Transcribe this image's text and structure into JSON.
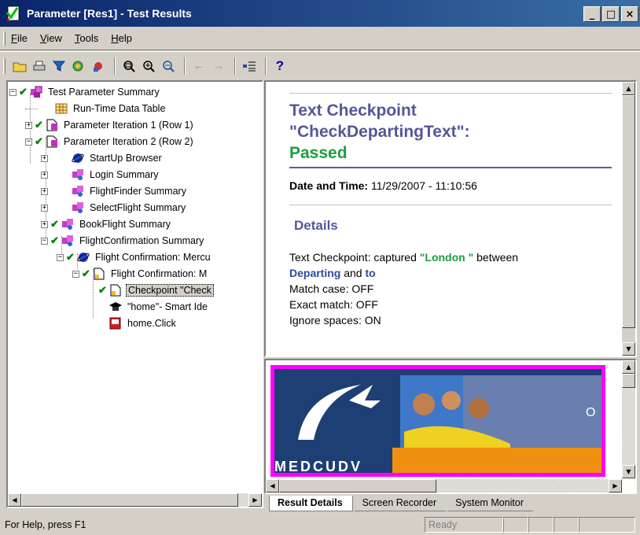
{
  "window": {
    "title": "Parameter [Res1] - Test Results",
    "min": "_",
    "max": "□",
    "close": "×"
  },
  "menu": [
    {
      "label": "File",
      "key": "F",
      "rest": "ile"
    },
    {
      "label": "View",
      "key": "V",
      "rest": "iew"
    },
    {
      "label": "Tools",
      "key": "T",
      "rest": "ools"
    },
    {
      "label": "Help",
      "key": "H",
      "rest": "elp"
    }
  ],
  "tree": {
    "root": "Test Parameter Summary",
    "runtime": "Run-Time Data Table",
    "iter1": "Parameter Iteration 1 (Row 1)",
    "iter2": "Parameter Iteration 2 (Row 2)",
    "startup": "StartUp Browser",
    "login": "Login Summary",
    "flightfinder": "FlightFinder Summary",
    "selectflight": "SelectFlight Summary",
    "bookflight": "BookFlight Summary",
    "confirmation": "FlightConfirmation Summary",
    "fc1": "Flight Confirmation: Mercu",
    "fc2": "Flight Confirmation: M",
    "checkpoint": "Checkpoint \"Check",
    "smart": "\"home\"- Smart Ide",
    "click": "home.Click"
  },
  "details": {
    "title_line1": "Text Checkpoint",
    "title_line2": "\"CheckDepartingText\":",
    "status": "Passed",
    "datetime_label": "Date and Time:",
    "datetime_value": "11/29/2007 - 11:10:56",
    "details_heading": "Details",
    "captured_prefix": "Text Checkpoint: captured ",
    "captured_value": "\"London \"",
    "captured_between": " between",
    "departing": "Departing",
    "and": " and ",
    "to": "to",
    "match_case": "Match case: OFF",
    "exact_match": "Exact match: OFF",
    "ignore_spaces": "Ignore spaces: ON"
  },
  "screenshot": {
    "brand_text": "MEDCUDV",
    "corner_letter": "O"
  },
  "tabs": [
    "Result Details",
    "Screen Recorder",
    "System Monitor"
  ],
  "status": {
    "help": "For Help, press F1",
    "ready": "Ready"
  }
}
